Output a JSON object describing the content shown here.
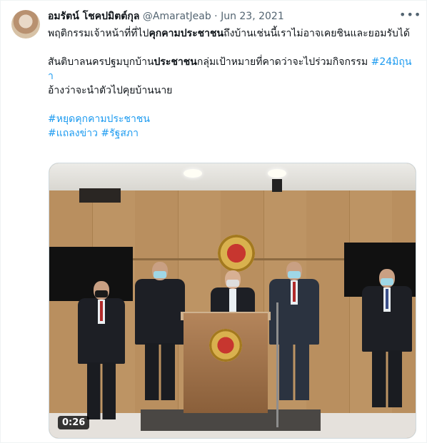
{
  "tweet": {
    "author_name": "อมรัตน์ โชคปมิตต์กุล",
    "handle": "@AmaratJeab",
    "separator": "·",
    "date": "Jun 23, 2021",
    "more_icon": "more-horizontal-icon",
    "line1_a": "พฤติกรรมเจ้าหน้าที่ที่ไป",
    "line1_b": "คุกคามประชาชน",
    "line1_c": "ถึงบ้านเช่นนี้เราไม่อาจเคยชินและยอมรับได้",
    "line2_a": "สันติบาลนครปฐมบุกบ้าน",
    "line2_b": "ประชาชน",
    "line2_c": "กลุ่มเป้าหมายที่คาดว่าจะไปร่วมกิจกรรม ",
    "line2_tag": "#24มิถุนา",
    "line3": "อ้างว่าจะนำตัวไปคุยบ้านนาย",
    "tag1": "#หยุดคุกคามประชาชน",
    "tag2": "#แถลงข่าว",
    "tag3": "#รัฐสภา"
  },
  "media": {
    "duration": "0:26"
  },
  "colors": {
    "link": "#1d9bf0",
    "secondary_text": "#536471",
    "border": "#cfd9de"
  }
}
